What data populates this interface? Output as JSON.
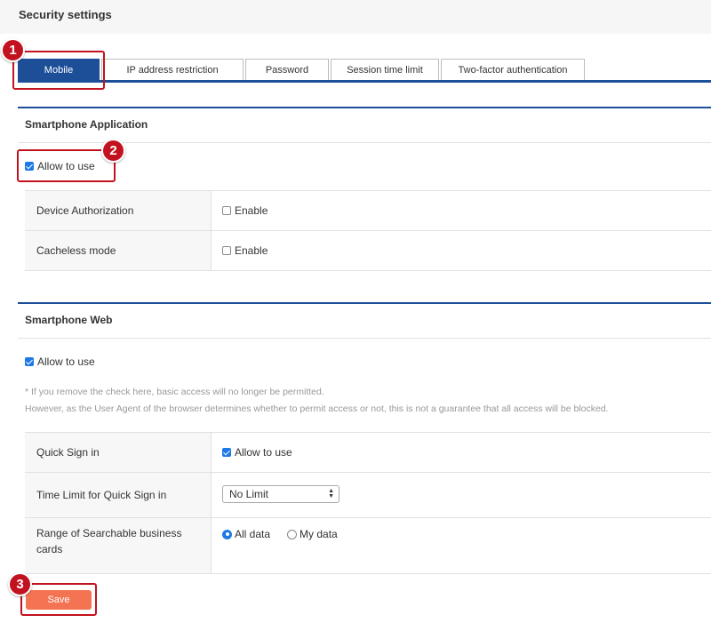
{
  "page": {
    "title": "Security settings"
  },
  "tabs": [
    {
      "label": "Mobile",
      "active": true
    },
    {
      "label": "IP address restriction"
    },
    {
      "label": "Password"
    },
    {
      "label": "Session time limit"
    },
    {
      "label": "Two-factor authentication"
    }
  ],
  "app_section": {
    "title": "Smartphone Application",
    "allow_label": "Allow to use",
    "allow_checked": true,
    "rows": [
      {
        "label": "Device Authorization",
        "value_label": "Enable",
        "checked": false
      },
      {
        "label": "Cacheless mode",
        "value_label": "Enable",
        "checked": false
      }
    ]
  },
  "web_section": {
    "title": "Smartphone Web",
    "allow_label": "Allow to use",
    "allow_checked": true,
    "note_line1": "* If you remove the check here, basic access will no longer be permitted.",
    "note_line2": "However, as the User Agent of the browser determines whether to permit access or not, this is not a guarantee that all access will be blocked.",
    "rows": {
      "quick_sign_in": {
        "label": "Quick Sign in",
        "value_label": "Allow to use",
        "checked": true
      },
      "time_limit": {
        "label": "Time Limit for Quick Sign in",
        "selected": "No Limit"
      },
      "range": {
        "label_line1": "Range of Searchable business",
        "label_line2": "cards",
        "option_all": "All data",
        "option_my": "My data",
        "selected": "All data"
      }
    }
  },
  "actions": {
    "save_label": "Save"
  },
  "badges": [
    "1",
    "2",
    "3"
  ],
  "colors": {
    "accent": "#1d4f99",
    "save": "#f47352",
    "highlight": "#c3121f",
    "checkbox": "#1e78e6"
  }
}
